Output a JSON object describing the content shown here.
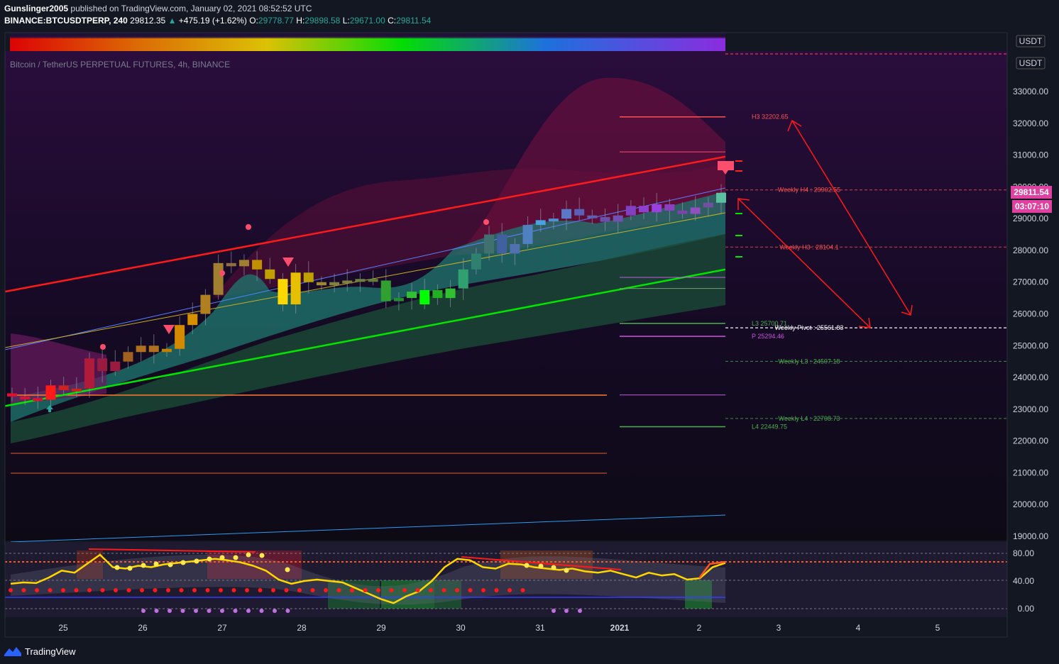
{
  "header": {
    "author": "Gunslinger2005",
    "published": "published on TradingView.com, January 02, 2021 08:52:52 UTC",
    "symbol": "BINANCE:BTCUSDTPERP, 240",
    "last": "29812.35",
    "change": "+475.19 (+1.62%)",
    "open_label": "O:",
    "open": "29778.77",
    "high_label": "H:",
    "high": "29898.58",
    "low_label": "L:",
    "low": "29671.00",
    "close_label": "C:",
    "close": "29811.54"
  },
  "chart_title": "Bitcoin / TetherUS PERPETUAL FUTURES, 4h, BINANCE",
  "currency_badge": "USDT",
  "price_badge": "29811.54",
  "countdown_badge": "03:07:10",
  "footer": {
    "brand": "TradingView"
  },
  "colors": {
    "background": "#131722",
    "bull_channel": "#00e600",
    "bear_channel": "#ff1a1a",
    "price_badge": "#e040a0",
    "rsi_line": "#ffd700",
    "rsi_overbought_line": "#ff5722"
  },
  "chart_data": [
    {
      "type": "candlestick",
      "title": "Bitcoin / TetherUS PERPETUAL FUTURES, 4h, BINANCE",
      "y_range": [
        18700,
        34100
      ],
      "y_ticks": [
        "19000.00",
        "20000.00",
        "21000.00",
        "22000.00",
        "23000.00",
        "24000.00",
        "25000.00",
        "26000.00",
        "27000.00",
        "28000.00",
        "29000.00",
        "30000.00",
        "31000.00",
        "32000.00",
        "33000.00"
      ],
      "x_ticks": [
        "25",
        "26",
        "27",
        "28",
        "29",
        "30",
        "31",
        "2021",
        "2",
        "3",
        "4",
        "5"
      ],
      "candles": [
        {
          "o": 23500,
          "c": 23400,
          "col": "#e01030"
        },
        {
          "o": 23400,
          "c": 23350,
          "col": "#e01030"
        },
        {
          "o": 23350,
          "c": 23300,
          "col": "#e01030"
        },
        {
          "o": 23300,
          "c": 23750,
          "col": "#ff1a1a"
        },
        {
          "o": 23750,
          "c": 23600,
          "col": "#cc2222"
        },
        {
          "o": 23600,
          "c": 23650,
          "col": "#cc2222"
        },
        {
          "o": 23650,
          "c": 24600,
          "col": "#b01b3a"
        },
        {
          "o": 24600,
          "c": 24200,
          "col": "#9a1a40"
        },
        {
          "o": 24200,
          "c": 24500,
          "col": "#9a1a40"
        },
        {
          "o": 24500,
          "c": 24800,
          "col": "#a06020"
        },
        {
          "o": 24800,
          "c": 25000,
          "col": "#b07020"
        },
        {
          "o": 25000,
          "c": 24800,
          "col": "#b07020"
        },
        {
          "o": 24800,
          "c": 24900,
          "col": "#c08000"
        },
        {
          "o": 24900,
          "c": 25650,
          "col": "#d38a00"
        },
        {
          "o": 25650,
          "c": 26000,
          "col": "#d49000"
        },
        {
          "o": 26000,
          "c": 26600,
          "col": "#b08020"
        },
        {
          "o": 26600,
          "c": 27600,
          "col": "#a08030"
        },
        {
          "o": 27600,
          "c": 27500,
          "col": "#907040"
        },
        {
          "o": 27500,
          "c": 27700,
          "col": "#a08030"
        },
        {
          "o": 27700,
          "c": 27400,
          "col": "#c09000"
        },
        {
          "o": 27400,
          "c": 27100,
          "col": "#c0a000"
        },
        {
          "o": 27100,
          "c": 26300,
          "col": "#ffd700"
        },
        {
          "o": 26300,
          "c": 27300,
          "col": "#e6c000"
        },
        {
          "o": 27300,
          "c": 27000,
          "col": "#c0a000"
        },
        {
          "o": 27000,
          "c": 26900,
          "col": "#a08830"
        },
        {
          "o": 26900,
          "c": 27000,
          "col": "#808040"
        },
        {
          "o": 27000,
          "c": 27050,
          "col": "#808040"
        },
        {
          "o": 27050,
          "c": 27100,
          "col": "#708040"
        },
        {
          "o": 27100,
          "c": 27050,
          "col": "#608040"
        },
        {
          "o": 27050,
          "c": 26400,
          "col": "#30a030"
        },
        {
          "o": 26400,
          "c": 26500,
          "col": "#209030"
        },
        {
          "o": 26500,
          "c": 26700,
          "col": "#30c030"
        },
        {
          "o": 26300,
          "c": 26750,
          "col": "#00ff00"
        },
        {
          "o": 26750,
          "c": 26500,
          "col": "#20b020"
        },
        {
          "o": 26500,
          "c": 26800,
          "col": "#30c030"
        },
        {
          "o": 26800,
          "c": 27400,
          "col": "#30a070"
        },
        {
          "o": 27400,
          "c": 27900,
          "col": "#308070"
        },
        {
          "o": 27900,
          "c": 28500,
          "col": "#407070"
        },
        {
          "o": 28500,
          "c": 27900,
          "col": "#4060a0"
        },
        {
          "o": 27900,
          "c": 28200,
          "col": "#5070b0"
        },
        {
          "o": 28200,
          "c": 28800,
          "col": "#5080c0"
        },
        {
          "o": 28800,
          "c": 28950,
          "col": "#4aa0e0"
        },
        {
          "o": 28950,
          "c": 29000,
          "col": "#5090d0"
        },
        {
          "o": 29000,
          "c": 29300,
          "col": "#5a78c8"
        },
        {
          "o": 29300,
          "c": 29100,
          "col": "#5a60b8"
        },
        {
          "o": 29100,
          "c": 29050,
          "col": "#6060b0"
        },
        {
          "o": 29050,
          "c": 28900,
          "col": "#6a50a8"
        },
        {
          "o": 28900,
          "c": 29100,
          "col": "#7050b0"
        },
        {
          "o": 29100,
          "c": 29400,
          "col": "#8040c0"
        },
        {
          "o": 29400,
          "c": 29200,
          "col": "#9040d0"
        },
        {
          "o": 29200,
          "c": 29450,
          "col": "#9a40e0"
        },
        {
          "o": 29450,
          "c": 29250,
          "col": "#8a40c0"
        },
        {
          "o": 29250,
          "c": 29150,
          "col": "#8040b0"
        },
        {
          "o": 29150,
          "c": 29350,
          "col": "#9050c0"
        },
        {
          "o": 29350,
          "c": 29500,
          "col": "#7050a0"
        },
        {
          "o": 29500,
          "c": 29812,
          "col": "#5ac0a0"
        }
      ],
      "channel_upper": [
        [
          0,
          26700
        ],
        [
          1015,
          30950
        ]
      ],
      "channel_lower": [
        [
          0,
          23100
        ],
        [
          1015,
          27400
        ]
      ],
      "pivot_levels": [
        {
          "label": "H3 32202.65",
          "price": 32202.65,
          "color": "#ff5050"
        },
        {
          "label": "Weekly H4 : 29902.55",
          "price": 29902.55,
          "color": "#ff5050"
        },
        {
          "label": "Weekly H3 : 28104.1",
          "price": 28104.1,
          "color": "#ff5050"
        },
        {
          "label": "L3 25700.71",
          "price": 25700.71,
          "color": "#4caf50"
        },
        {
          "label": "Weekly Pivot : 25561.83",
          "price": 25561.83,
          "color": "#ffffff"
        },
        {
          "label": "P 25294.46",
          "price": 25294.46,
          "color": "#d050e0"
        },
        {
          "label": "Weekly L3 : 24507.18",
          "price": 24507.18,
          "color": "#4caf50"
        },
        {
          "label": "Weekly L4 : 22708.73",
          "price": 22708.73,
          "color": "#4caf50"
        },
        {
          "label": "L4 22449.75",
          "price": 22449.75,
          "color": "#4caf50"
        }
      ]
    },
    {
      "type": "line",
      "title": "RSI oscillator",
      "y_range": [
        -5,
        92
      ],
      "y_ticks": [
        "80.00",
        "40.00",
        "0.00"
      ],
      "values": [
        36,
        38,
        37,
        45,
        55,
        52,
        65,
        78,
        60,
        58,
        62,
        60,
        64,
        66,
        68,
        70,
        72,
        70,
        67,
        62,
        55,
        42,
        36,
        40,
        42,
        40,
        38,
        30,
        22,
        14,
        8,
        18,
        25,
        40,
        60,
        72,
        70,
        60,
        58,
        65,
        64,
        60,
        58,
        56,
        58,
        54,
        52,
        55,
        50,
        45,
        52,
        48,
        50,
        42,
        44,
        60,
        66
      ]
    }
  ]
}
